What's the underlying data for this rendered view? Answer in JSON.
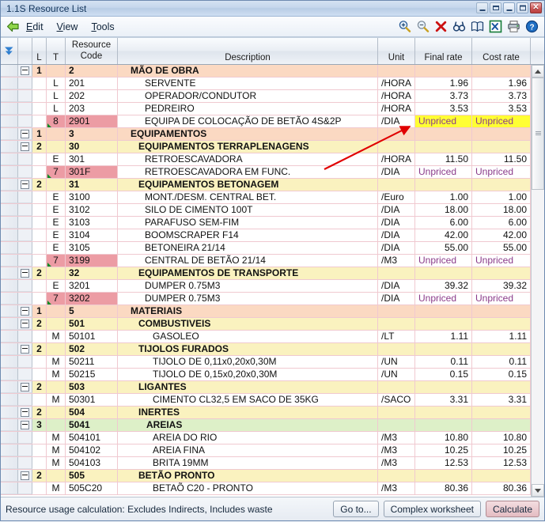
{
  "window": {
    "title": "1.1S Resource List",
    "buttons": [
      {
        "name": "mdi-minimize",
        "glyph": "minimize"
      },
      {
        "name": "mdi-restore",
        "glyph": "restore"
      },
      {
        "name": "minimize",
        "glyph": "minimize"
      },
      {
        "name": "maximize",
        "glyph": "maximize"
      },
      {
        "name": "close",
        "glyph": "close",
        "color": "#c0392b"
      }
    ]
  },
  "menubar": {
    "back_icon": "back-arrow-icon",
    "items": [
      {
        "label": "Edit",
        "mnemonic": "E"
      },
      {
        "label": "View",
        "mnemonic": "V"
      },
      {
        "label": "Tools",
        "mnemonic": "T"
      }
    ],
    "tools": [
      {
        "name": "zoom-in-icon"
      },
      {
        "name": "zoom-out-icon"
      },
      {
        "name": "delete-icon"
      },
      {
        "name": "find-icon"
      },
      {
        "name": "book-icon"
      },
      {
        "name": "export-excel-icon"
      },
      {
        "name": "print-icon"
      },
      {
        "name": "help-icon"
      }
    ]
  },
  "grid": {
    "columns": [
      {
        "key": "filter",
        "label": ""
      },
      {
        "key": "expander",
        "label": ""
      },
      {
        "key": "l",
        "label": "L"
      },
      {
        "key": "t",
        "label": "T"
      },
      {
        "key": "code",
        "label_top": "Resource",
        "label": "Code"
      },
      {
        "key": "description",
        "label": "Description"
      },
      {
        "key": "unit",
        "label": "Unit"
      },
      {
        "key": "final_rate",
        "label": "Final rate"
      },
      {
        "key": "cost_rate",
        "label": "Cost rate"
      }
    ],
    "rows": [
      {
        "kind": "group",
        "level": "1",
        "l": "1",
        "t": "",
        "code": "2",
        "description": "MÃO DE OBRA",
        "unit": "",
        "final_rate": "",
        "cost_rate": "",
        "indent": 0
      },
      {
        "kind": "leaf",
        "level": "",
        "l": "",
        "t": "L",
        "code": "201",
        "description": "SERVENTE",
        "unit": "/HORA",
        "final_rate": "1.96",
        "cost_rate": "1.96",
        "indent": 1
      },
      {
        "kind": "leaf",
        "level": "",
        "l": "",
        "t": "L",
        "code": "202",
        "description": "OPERADOR/CONDUTOR",
        "unit": "/HORA",
        "final_rate": "3.73",
        "cost_rate": "3.73",
        "indent": 1
      },
      {
        "kind": "leaf",
        "level": "",
        "l": "",
        "t": "L",
        "code": "203",
        "description": "PEDREIRO",
        "unit": "/HORA",
        "final_rate": "3.53",
        "cost_rate": "3.53",
        "indent": 1
      },
      {
        "kind": "leaf",
        "level": "",
        "l": "",
        "t": "8",
        "code": "2901",
        "description": "EQUIPA DE COLOCAÇÃO DE BETÃO 4S&2P",
        "unit": "/DIA",
        "final_rate": "Unpriced",
        "cost_rate": "Unpriced",
        "indent": 1,
        "pink": true,
        "flag": true,
        "highlight": true
      },
      {
        "kind": "group",
        "level": "1",
        "l": "1",
        "t": "",
        "code": "3",
        "description": "EQUIPAMENTOS",
        "unit": "",
        "final_rate": "",
        "cost_rate": "",
        "indent": 0
      },
      {
        "kind": "group",
        "level": "2",
        "l": "2",
        "t": "",
        "code": "30",
        "description": "EQUIPAMENTOS TERRAPLENAGENS",
        "unit": "",
        "final_rate": "",
        "cost_rate": "",
        "indent": 1
      },
      {
        "kind": "leaf",
        "level": "",
        "l": "",
        "t": "E",
        "code": "301",
        "description": "RETROESCAVADORA",
        "unit": "/HORA",
        "final_rate": "11.50",
        "cost_rate": "11.50",
        "indent": 1
      },
      {
        "kind": "leaf",
        "level": "",
        "l": "",
        "t": "7",
        "code": "301F",
        "description": "RETROESCAVADORA EM FUNC.",
        "unit": "/DIA",
        "final_rate": "Unpriced",
        "cost_rate": "Unpriced",
        "indent": 1,
        "pink": true,
        "flag": true
      },
      {
        "kind": "group",
        "level": "2",
        "l": "2",
        "t": "",
        "code": "31",
        "description": "EQUIPAMENTOS BETONAGEM",
        "unit": "",
        "final_rate": "",
        "cost_rate": "",
        "indent": 1
      },
      {
        "kind": "leaf",
        "level": "",
        "l": "",
        "t": "E",
        "code": "3100",
        "description": "MONT./DESM. CENTRAL BET.",
        "unit": "/Euro",
        "final_rate": "1.00",
        "cost_rate": "1.00",
        "indent": 1
      },
      {
        "kind": "leaf",
        "level": "",
        "l": "",
        "t": "E",
        "code": "3102",
        "description": "SILO DE CIMENTO  100T",
        "unit": "/DIA",
        "final_rate": "18.00",
        "cost_rate": "18.00",
        "indent": 1
      },
      {
        "kind": "leaf",
        "level": "",
        "l": "",
        "t": "E",
        "code": "3103",
        "description": "PARAFUSO SEM-FIM",
        "unit": "/DIA",
        "final_rate": "6.00",
        "cost_rate": "6.00",
        "indent": 1
      },
      {
        "kind": "leaf",
        "level": "",
        "l": "",
        "t": "E",
        "code": "3104",
        "description": "BOOMSCRAPER F14",
        "unit": "/DIA",
        "final_rate": "42.00",
        "cost_rate": "42.00",
        "indent": 1
      },
      {
        "kind": "leaf",
        "level": "",
        "l": "",
        "t": "E",
        "code": "3105",
        "description": "BETONEIRA 21/14",
        "unit": "/DIA",
        "final_rate": "55.00",
        "cost_rate": "55.00",
        "indent": 1
      },
      {
        "kind": "leaf",
        "level": "",
        "l": "",
        "t": "7",
        "code": "3199",
        "description": "CENTRAL DE BETÃO  21/14",
        "unit": "/M3",
        "final_rate": "Unpriced",
        "cost_rate": "Unpriced",
        "indent": 1,
        "pink": true,
        "flag": true
      },
      {
        "kind": "group",
        "level": "2",
        "l": "2",
        "t": "",
        "code": "32",
        "description": "EQUIPAMENTOS DE TRANSPORTE",
        "unit": "",
        "final_rate": "",
        "cost_rate": "",
        "indent": 1
      },
      {
        "kind": "leaf",
        "level": "",
        "l": "",
        "t": "E",
        "code": "3201",
        "description": "DUMPER  0.75M3",
        "unit": "/DIA",
        "final_rate": "39.32",
        "cost_rate": "39.32",
        "indent": 1
      },
      {
        "kind": "leaf",
        "level": "",
        "l": "",
        "t": "7",
        "code": "3202",
        "description": "DUMPER  0.75M3",
        "unit": "/DIA",
        "final_rate": "Unpriced",
        "cost_rate": "Unpriced",
        "indent": 1,
        "pink": true,
        "flag": true
      },
      {
        "kind": "group",
        "level": "1",
        "l": "1",
        "t": "",
        "code": "5",
        "description": "MATERIAIS",
        "unit": "",
        "final_rate": "",
        "cost_rate": "",
        "indent": 0
      },
      {
        "kind": "group",
        "level": "2",
        "l": "2",
        "t": "",
        "code": "501",
        "description": "COMBUSTIVEIS",
        "unit": "",
        "final_rate": "",
        "cost_rate": "",
        "indent": 1
      },
      {
        "kind": "leaf",
        "level": "",
        "l": "",
        "t": "M",
        "code": "50101",
        "description": "GASOLEO",
        "unit": "/LT",
        "final_rate": "1.11",
        "cost_rate": "1.11",
        "indent": 2
      },
      {
        "kind": "group",
        "level": "2",
        "l": "2",
        "t": "",
        "code": "502",
        "description": "TIJOLOS FURADOS",
        "unit": "",
        "final_rate": "",
        "cost_rate": "",
        "indent": 1
      },
      {
        "kind": "leaf",
        "level": "",
        "l": "",
        "t": "M",
        "code": "50211",
        "description": "TIJOLO DE 0,11x0,20x0,30M",
        "unit": "/UN",
        "final_rate": "0.11",
        "cost_rate": "0.11",
        "indent": 2
      },
      {
        "kind": "leaf",
        "level": "",
        "l": "",
        "t": "M",
        "code": "50215",
        "description": "TIJOLO DE 0,15x0,20x0,30M",
        "unit": "/UN",
        "final_rate": "0.15",
        "cost_rate": "0.15",
        "indent": 2
      },
      {
        "kind": "group",
        "level": "2",
        "l": "2",
        "t": "",
        "code": "503",
        "description": "LIGANTES",
        "unit": "",
        "final_rate": "",
        "cost_rate": "",
        "indent": 1
      },
      {
        "kind": "leaf",
        "level": "",
        "l": "",
        "t": "M",
        "code": "50301",
        "description": "CIMENTO CL32,5 EM SACO DE 35KG",
        "unit": "/SACO",
        "final_rate": "3.31",
        "cost_rate": "3.31",
        "indent": 2
      },
      {
        "kind": "group",
        "level": "2",
        "l": "2",
        "t": "",
        "code": "504",
        "description": "INERTES",
        "unit": "",
        "final_rate": "",
        "cost_rate": "",
        "indent": 1
      },
      {
        "kind": "group",
        "level": "3",
        "l": "3",
        "t": "",
        "code": "5041",
        "description": "AREIAS",
        "unit": "",
        "final_rate": "",
        "cost_rate": "",
        "indent": 2
      },
      {
        "kind": "leaf",
        "level": "",
        "l": "",
        "t": "M",
        "code": "504101",
        "description": "AREIA DO RIO",
        "unit": "/M3",
        "final_rate": "10.80",
        "cost_rate": "10.80",
        "indent": 3
      },
      {
        "kind": "leaf",
        "level": "",
        "l": "",
        "t": "M",
        "code": "504102",
        "description": "AREIA FINA",
        "unit": "/M3",
        "final_rate": "10.25",
        "cost_rate": "10.25",
        "indent": 3
      },
      {
        "kind": "leaf",
        "level": "",
        "l": "",
        "t": "M",
        "code": "504103",
        "description": "BRITA 19MM",
        "unit": "/M3",
        "final_rate": "12.53",
        "cost_rate": "12.53",
        "indent": 3
      },
      {
        "kind": "group",
        "level": "2",
        "l": "2",
        "t": "",
        "code": "505",
        "description": "BETÃO PRONTO",
        "unit": "",
        "final_rate": "",
        "cost_rate": "",
        "indent": 1
      },
      {
        "kind": "leaf",
        "level": "",
        "l": "",
        "t": "M",
        "code": "505C20",
        "description": "BETAÕ C20 - PRONTO",
        "unit": "/M3",
        "final_rate": "80.36",
        "cost_rate": "80.36",
        "indent": 2
      }
    ]
  },
  "statusbar": {
    "text": "Resource usage calculation: Excludes Indirects, Includes waste",
    "buttons": [
      {
        "label": "Go to...",
        "name": "go-to-button"
      },
      {
        "label": "Complex worksheet",
        "name": "complex-worksheet-button"
      },
      {
        "label": "Calculate",
        "name": "calculate-button",
        "accent": "#e4bcc2"
      }
    ]
  },
  "annotation": {
    "type": "arrow",
    "color": "#e00000"
  }
}
